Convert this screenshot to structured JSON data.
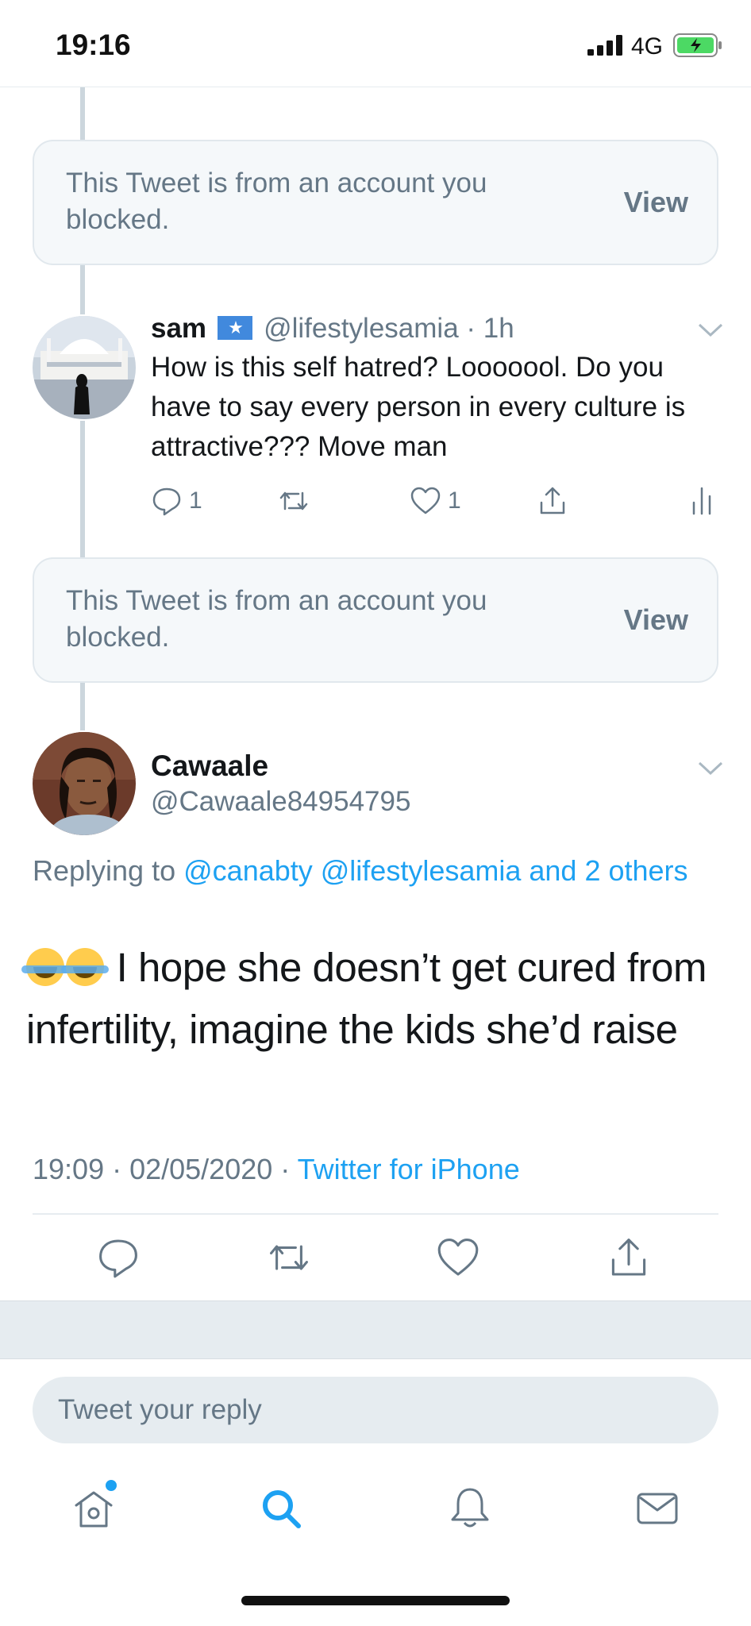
{
  "status_bar": {
    "time": "19:16",
    "network": "4G"
  },
  "blocked_tweets": [
    {
      "text": "This Tweet is from an account you blocked.",
      "action": "View"
    },
    {
      "text": "This Tweet is from an account you blocked.",
      "action": "View"
    }
  ],
  "reply_tweet": {
    "name": "sam",
    "handle": "@lifestylesamia",
    "time": "· 1h",
    "text": "How is this self hatred? Looooool. Do you have to say every person in every culture is attractive??? Move man",
    "reply_count": "1",
    "like_count": "1"
  },
  "focused_tweet": {
    "name": "Cawaale",
    "handle": "@Cawaale84954795",
    "replying_prefix": "Replying to",
    "replying_to": "@canabty @lifestylesamia and 2 others",
    "text": "I hope she doesn’t get cured from infertility, imagine the kids she’d raise",
    "timestamp": "19:09 · 02/05/2020 ·",
    "source": "Twitter for iPhone"
  },
  "reply_input": {
    "placeholder": "Tweet your reply"
  },
  "colors": {
    "accent": "#1da1f2",
    "secondary_text": "#657786",
    "divider": "#e6ecf0",
    "flag": "#4189dd"
  },
  "icons": [
    "signal-icon",
    "battery-icon",
    "chevron-down-icon",
    "reply-icon",
    "retweet-icon",
    "like-icon",
    "share-icon",
    "analytics-icon",
    "home-icon",
    "search-icon",
    "notifications-icon",
    "messages-icon"
  ]
}
